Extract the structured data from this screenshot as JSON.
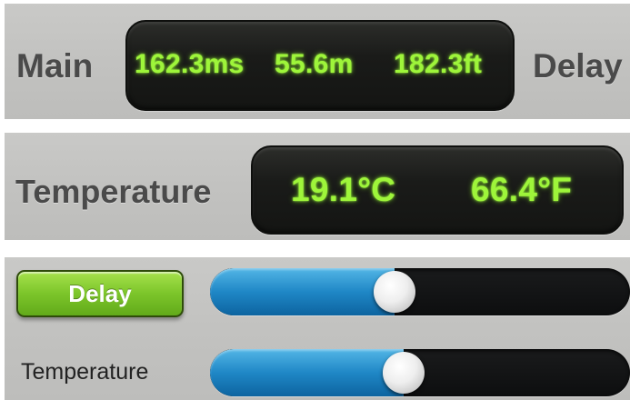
{
  "main_row": {
    "label": "Main",
    "time": "162.3ms",
    "meters": "55.6m",
    "feet": "182.3ft",
    "trailing_label": "Delay"
  },
  "temperature_row": {
    "label": "Temperature",
    "celsius": "19.1°C",
    "fahrenheit": "66.4°F"
  },
  "controls": {
    "delay_button_label": "Delay",
    "delay_slider_fraction": 0.44,
    "temperature_label": "Temperature",
    "temperature_slider_fraction": 0.46
  },
  "colors": {
    "lcd_text": "#9ef53a",
    "button_green": "#7cc52a",
    "slider_blue": "#1f87c6"
  }
}
